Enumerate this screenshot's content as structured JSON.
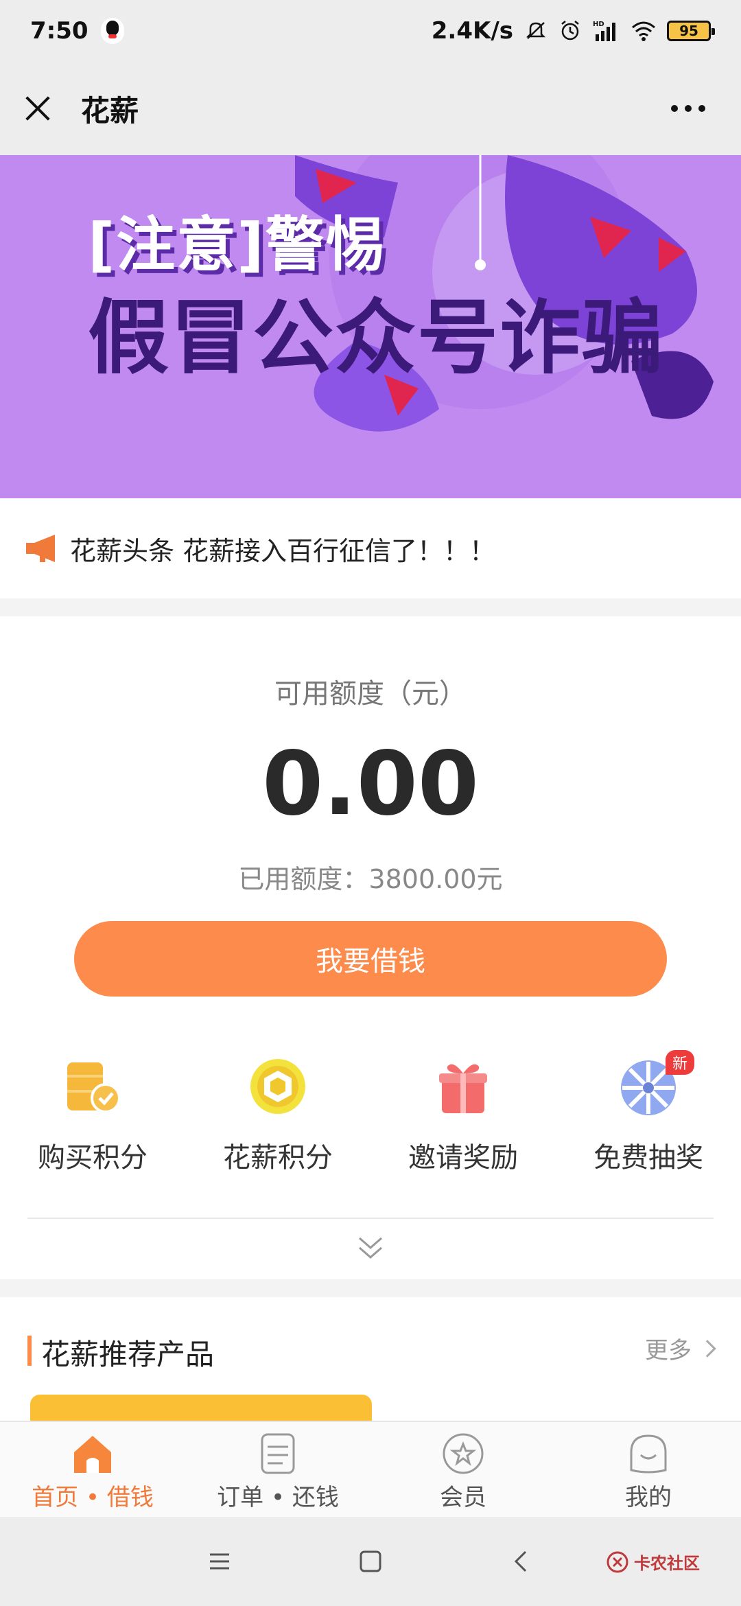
{
  "status_bar": {
    "time": "7:50",
    "net_speed": "2.4K/s",
    "signal": "HD",
    "battery": "95",
    "icons": [
      "qq-icon",
      "mute-icon",
      "alarm-icon",
      "cell-signal-icon",
      "wifi-icon",
      "battery-icon"
    ]
  },
  "title_bar": {
    "title": "花薪",
    "close_icon": "close-icon",
    "more_icon": "more-icon"
  },
  "banner": {
    "line1": "[注意]警惕",
    "line2": "假冒公众号诈骗",
    "background_color": "#c08af0"
  },
  "headline": {
    "tag": "花薪头条",
    "text": "花薪接入百行征信了！！！",
    "icon": "megaphone-icon"
  },
  "credit": {
    "available_label": "可用额度（元）",
    "available_amount": "0.00",
    "used_label": "已用额度：3800.00元",
    "borrow_button": "我要借钱",
    "accent_color": "#fd8b4b"
  },
  "features": [
    {
      "label": "购买积分",
      "icon": "coins-icon"
    },
    {
      "label": "花薪积分",
      "icon": "points-icon"
    },
    {
      "label": "邀请奖励",
      "icon": "gift-icon"
    },
    {
      "label": "免费抽奖",
      "icon": "lottery-wheel-icon",
      "badge": "新"
    }
  ],
  "recommend": {
    "title": "花薪推荐产品",
    "more": "更多"
  },
  "bottom_nav": [
    {
      "label": "首页 • 借钱",
      "icon": "home-icon",
      "active": true
    },
    {
      "label": "订单 • 还钱",
      "icon": "order-icon",
      "active": false
    },
    {
      "label": "会员",
      "icon": "star-icon",
      "active": false
    },
    {
      "label": "我的",
      "icon": "profile-icon",
      "active": false
    }
  ],
  "system_nav": {
    "watermark": "卡农社区"
  }
}
